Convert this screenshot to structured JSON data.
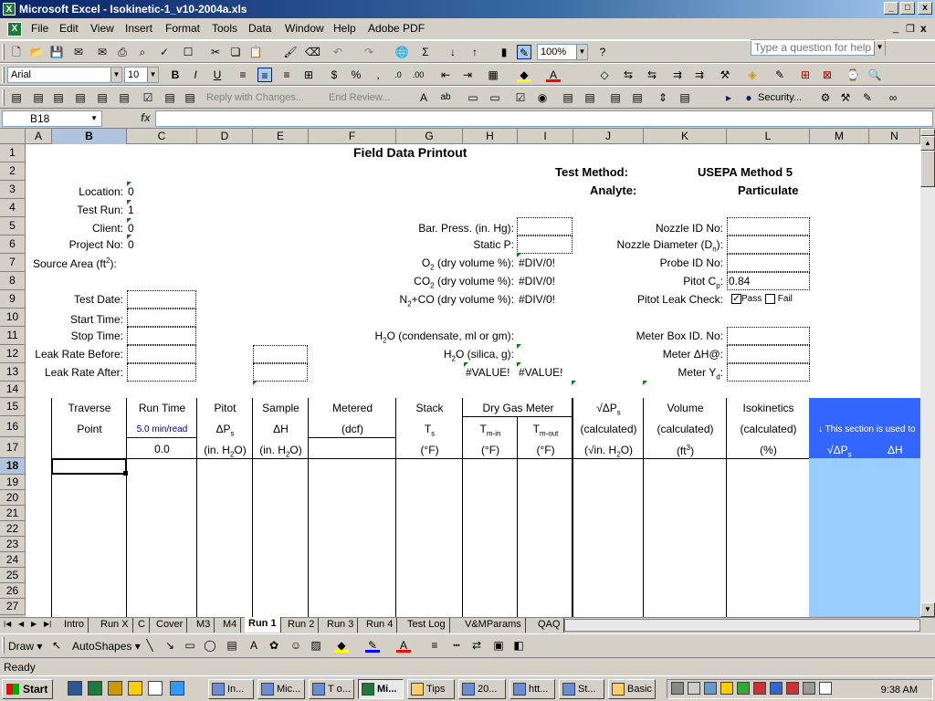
{
  "window": {
    "title": "Microsoft Excel - Isokinetic-1_v10-2004a.xls",
    "min": "_",
    "max": "□",
    "close": "x"
  },
  "menu": {
    "items": [
      "File",
      "Edit",
      "View",
      "Insert",
      "Format",
      "Tools",
      "Data",
      "Window",
      "Help",
      "Adobe PDF"
    ],
    "help_placeholder": "Type a question for help"
  },
  "toolbar": {
    "zoom": "100%",
    "font": "Arial",
    "size": "10",
    "reply_label": "Reply with Changes...",
    "end_review": "End Review...",
    "security": "Security..."
  },
  "formula": {
    "cell_ref": "B18",
    "fx": "fx",
    "content": ""
  },
  "columns": [
    "A",
    "B",
    "C",
    "D",
    "E",
    "F",
    "G",
    "H",
    "I",
    "J",
    "K",
    "L",
    "M",
    "N"
  ],
  "rows": [
    "1",
    "2",
    "3",
    "4",
    "5",
    "6",
    "7",
    "8",
    "9",
    "10",
    "11",
    "12",
    "13",
    "14",
    "15",
    "16",
    "17",
    "18",
    "19",
    "20",
    "21",
    "22",
    "23",
    "24",
    "25",
    "26",
    "27"
  ],
  "sheet": {
    "title": "Field Data Printout",
    "test_method_label": "Test Method:",
    "test_method_value": "USEPA Method 5",
    "analyte_label": "Analyte:",
    "analyte_value": "Particulate",
    "location_label": "Location:",
    "location_value": "0",
    "test_run_label": "Test Run:",
    "test_run_value": "1",
    "client_label": "Client:",
    "client_value": "0",
    "project_label": "Project No:",
    "project_value": "0",
    "source_area_label": "Source Area (ft",
    "bar_press_label": "Bar. Press. (in. Hg):",
    "static_p_label": "Static P:",
    "o2_label": "(dry volume %):",
    "o2_value": "#DIV/0!",
    "co2_label": "(dry volume %):",
    "co2_value": "#DIV/0!",
    "n2_label": "+CO (dry volume %):",
    "n2_value": "#DIV/0!",
    "nozzle_id_label": "Nozzle ID No:",
    "nozzle_diam_label": "Nozzle Diameter (D",
    "probe_id_label": "Probe ID No:",
    "pitot_cp_label": "Pitot C",
    "pitot_cp_value": "0.84",
    "pitot_leak_label": "Pitot Leak Check:",
    "pass_label": "Pass",
    "fail_label": "Fail",
    "test_date_label": "Test Date:",
    "start_time_label": "Start Time:",
    "stop_time_label": "Stop Time:",
    "leak_before_label": "Leak Rate Before:",
    "leak_after_label": "Leak Rate After:",
    "h2o_cond_label": "O (condensate, ml or gm):",
    "h2o_silica_label": "O (silica, g):",
    "value_err1": "#VALUE!",
    "value_err2": "#VALUE!",
    "meter_box_label": "Meter Box ID. No:",
    "meter_dh_label": "Meter ΔH@:",
    "meter_yd_label": "Meter Y",
    "hdr_traverse": "Traverse",
    "hdr_point": "Point",
    "hdr_runtime": "Run Time",
    "hdr_minread": "5.0 min/read",
    "hdr_runtime_value": "0.0",
    "hdr_pitot": "Pitot",
    "hdr_dps": "ΔP",
    "hdr_inh2o": "(in. H",
    "hdr_sample": "Sample",
    "hdr_dh": "ΔH",
    "hdr_inh2o2": "(in. H",
    "hdr_metered": "Metered",
    "hdr_dcf": "(dcf)",
    "hdr_stack": "Stack",
    "hdr_ts": "T",
    "hdr_degf": "(°F)",
    "hdr_drygas": "Dry Gas Meter",
    "hdr_tmin": "T",
    "hdr_tmout": "T",
    "hdr_degf2": "(°F)",
    "hdr_degf3": "(°F)",
    "hdr_sqrtdps": "√ΔP",
    "hdr_calc1": "(calculated)",
    "hdr_sqrtin": "(√in. H",
    "hdr_volume": "Volume",
    "hdr_calc2": "(calculated)",
    "hdr_ft3": "(ft",
    "hdr_iso": "Isokinetics",
    "hdr_calc3": "(calculated)",
    "hdr_pct": "(%)",
    "blue_note": "↓ This section is used to",
    "blue_sqrt": "√ΔP",
    "blue_dh": "ΔH"
  },
  "tabs": [
    "Intro",
    "Run X",
    "C",
    "Cover",
    "M3",
    "M4",
    "Run 1",
    "Run 2",
    "Run 3",
    "Run 4",
    "Test Log",
    "V&MParams",
    "QAQ"
  ],
  "drawbar": {
    "draw": "Draw",
    "autoshapes": "AutoShapes"
  },
  "status": "Ready",
  "taskbar": {
    "start": "Start",
    "tasks": [
      "In...",
      "Mic...",
      "T o...",
      "Mi...",
      "Tips",
      "20...",
      "htt...",
      "St...",
      "Basic"
    ],
    "clock": "9:38 AM"
  }
}
